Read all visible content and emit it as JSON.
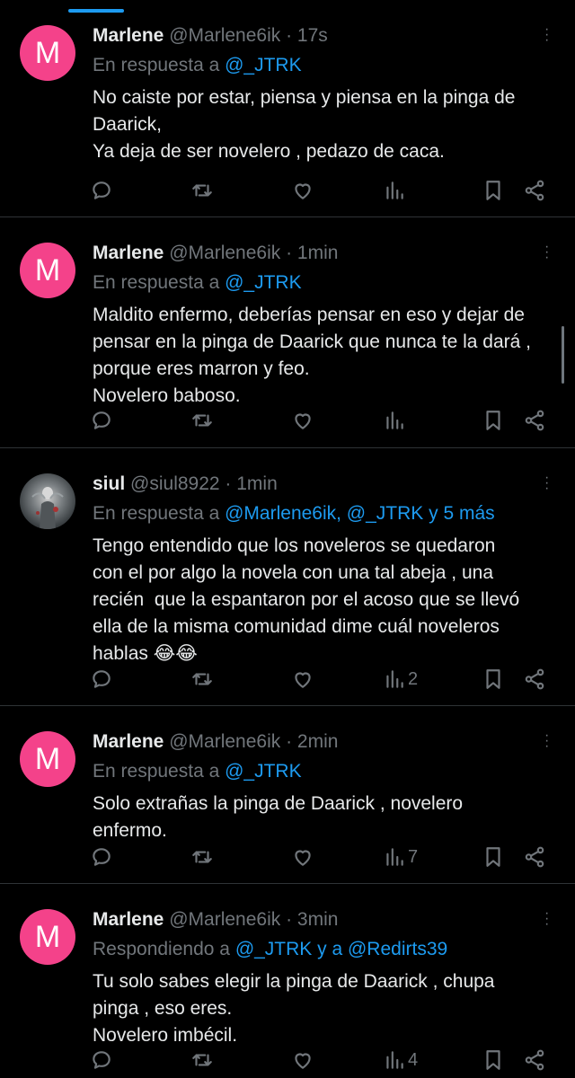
{
  "tweets": [
    {
      "avatar_letter": "M",
      "name": "Marlene",
      "handle": "@Marlene6ik",
      "time": "17s",
      "reply_prefix": "En respuesta a",
      "reply_to": "@_JTRK",
      "text": "No caiste por estar, piensa y piensa en la pinga de\nDaarick,\nYa deja de ser novelero , pedazo de caca.",
      "views": ""
    },
    {
      "avatar_letter": "M",
      "name": "Marlene",
      "handle": "@Marlene6ik",
      "time": "1min",
      "reply_prefix": "En respuesta a",
      "reply_to": "@_JTRK",
      "text": "Maldito enfermo, deberías pensar en eso y dejar de\npensar en la pinga de Daarick que nunca te la dará ,\nporque eres marron y feo.\nNovelero baboso.",
      "views": ""
    },
    {
      "avatar_letter": "",
      "name": "siul",
      "handle": "@siul8922",
      "time": "1min",
      "reply_prefix": "En respuesta a",
      "reply_to": "@Marlene6ik, @_JTRK y 5 más",
      "text": "Tengo entendido que los noveleros se quedaron\ncon el por algo la novela con una tal abeja , una\nrecién  que la espantaron por el acoso que se llevó\nella de la misma comunidad dime cuál noveleros\nhablas 😂😂",
      "views": "2"
    },
    {
      "avatar_letter": "M",
      "name": "Marlene",
      "handle": "@Marlene6ik",
      "time": "2min",
      "reply_prefix": "En respuesta a",
      "reply_to": "@_JTRK",
      "text": "Solo extrañas la pinga de Daarick , novelero\nenfermo.",
      "views": "7"
    },
    {
      "avatar_letter": "M",
      "name": "Marlene",
      "handle": "@Marlene6ik",
      "time": "3min",
      "reply_prefix": "Respondiendo a",
      "reply_to": "@_JTRK y a @Redirts39",
      "text": "Tu solo sabes elegir la pinga de Daarick , chupa\npinga , eso eres.\nNovelero imbécil.",
      "views": "4"
    }
  ],
  "separator": " · ",
  "colors": {
    "background": "#000000",
    "text": "#e7e9ea",
    "muted": "#71767b",
    "accent": "#1d9bf0",
    "avatar": "#f4428a",
    "divider": "#2f3336"
  },
  "icons": [
    "reply-icon",
    "retweet-icon",
    "like-icon",
    "views-icon",
    "bookmark-icon",
    "share-icon",
    "more-icon"
  ]
}
